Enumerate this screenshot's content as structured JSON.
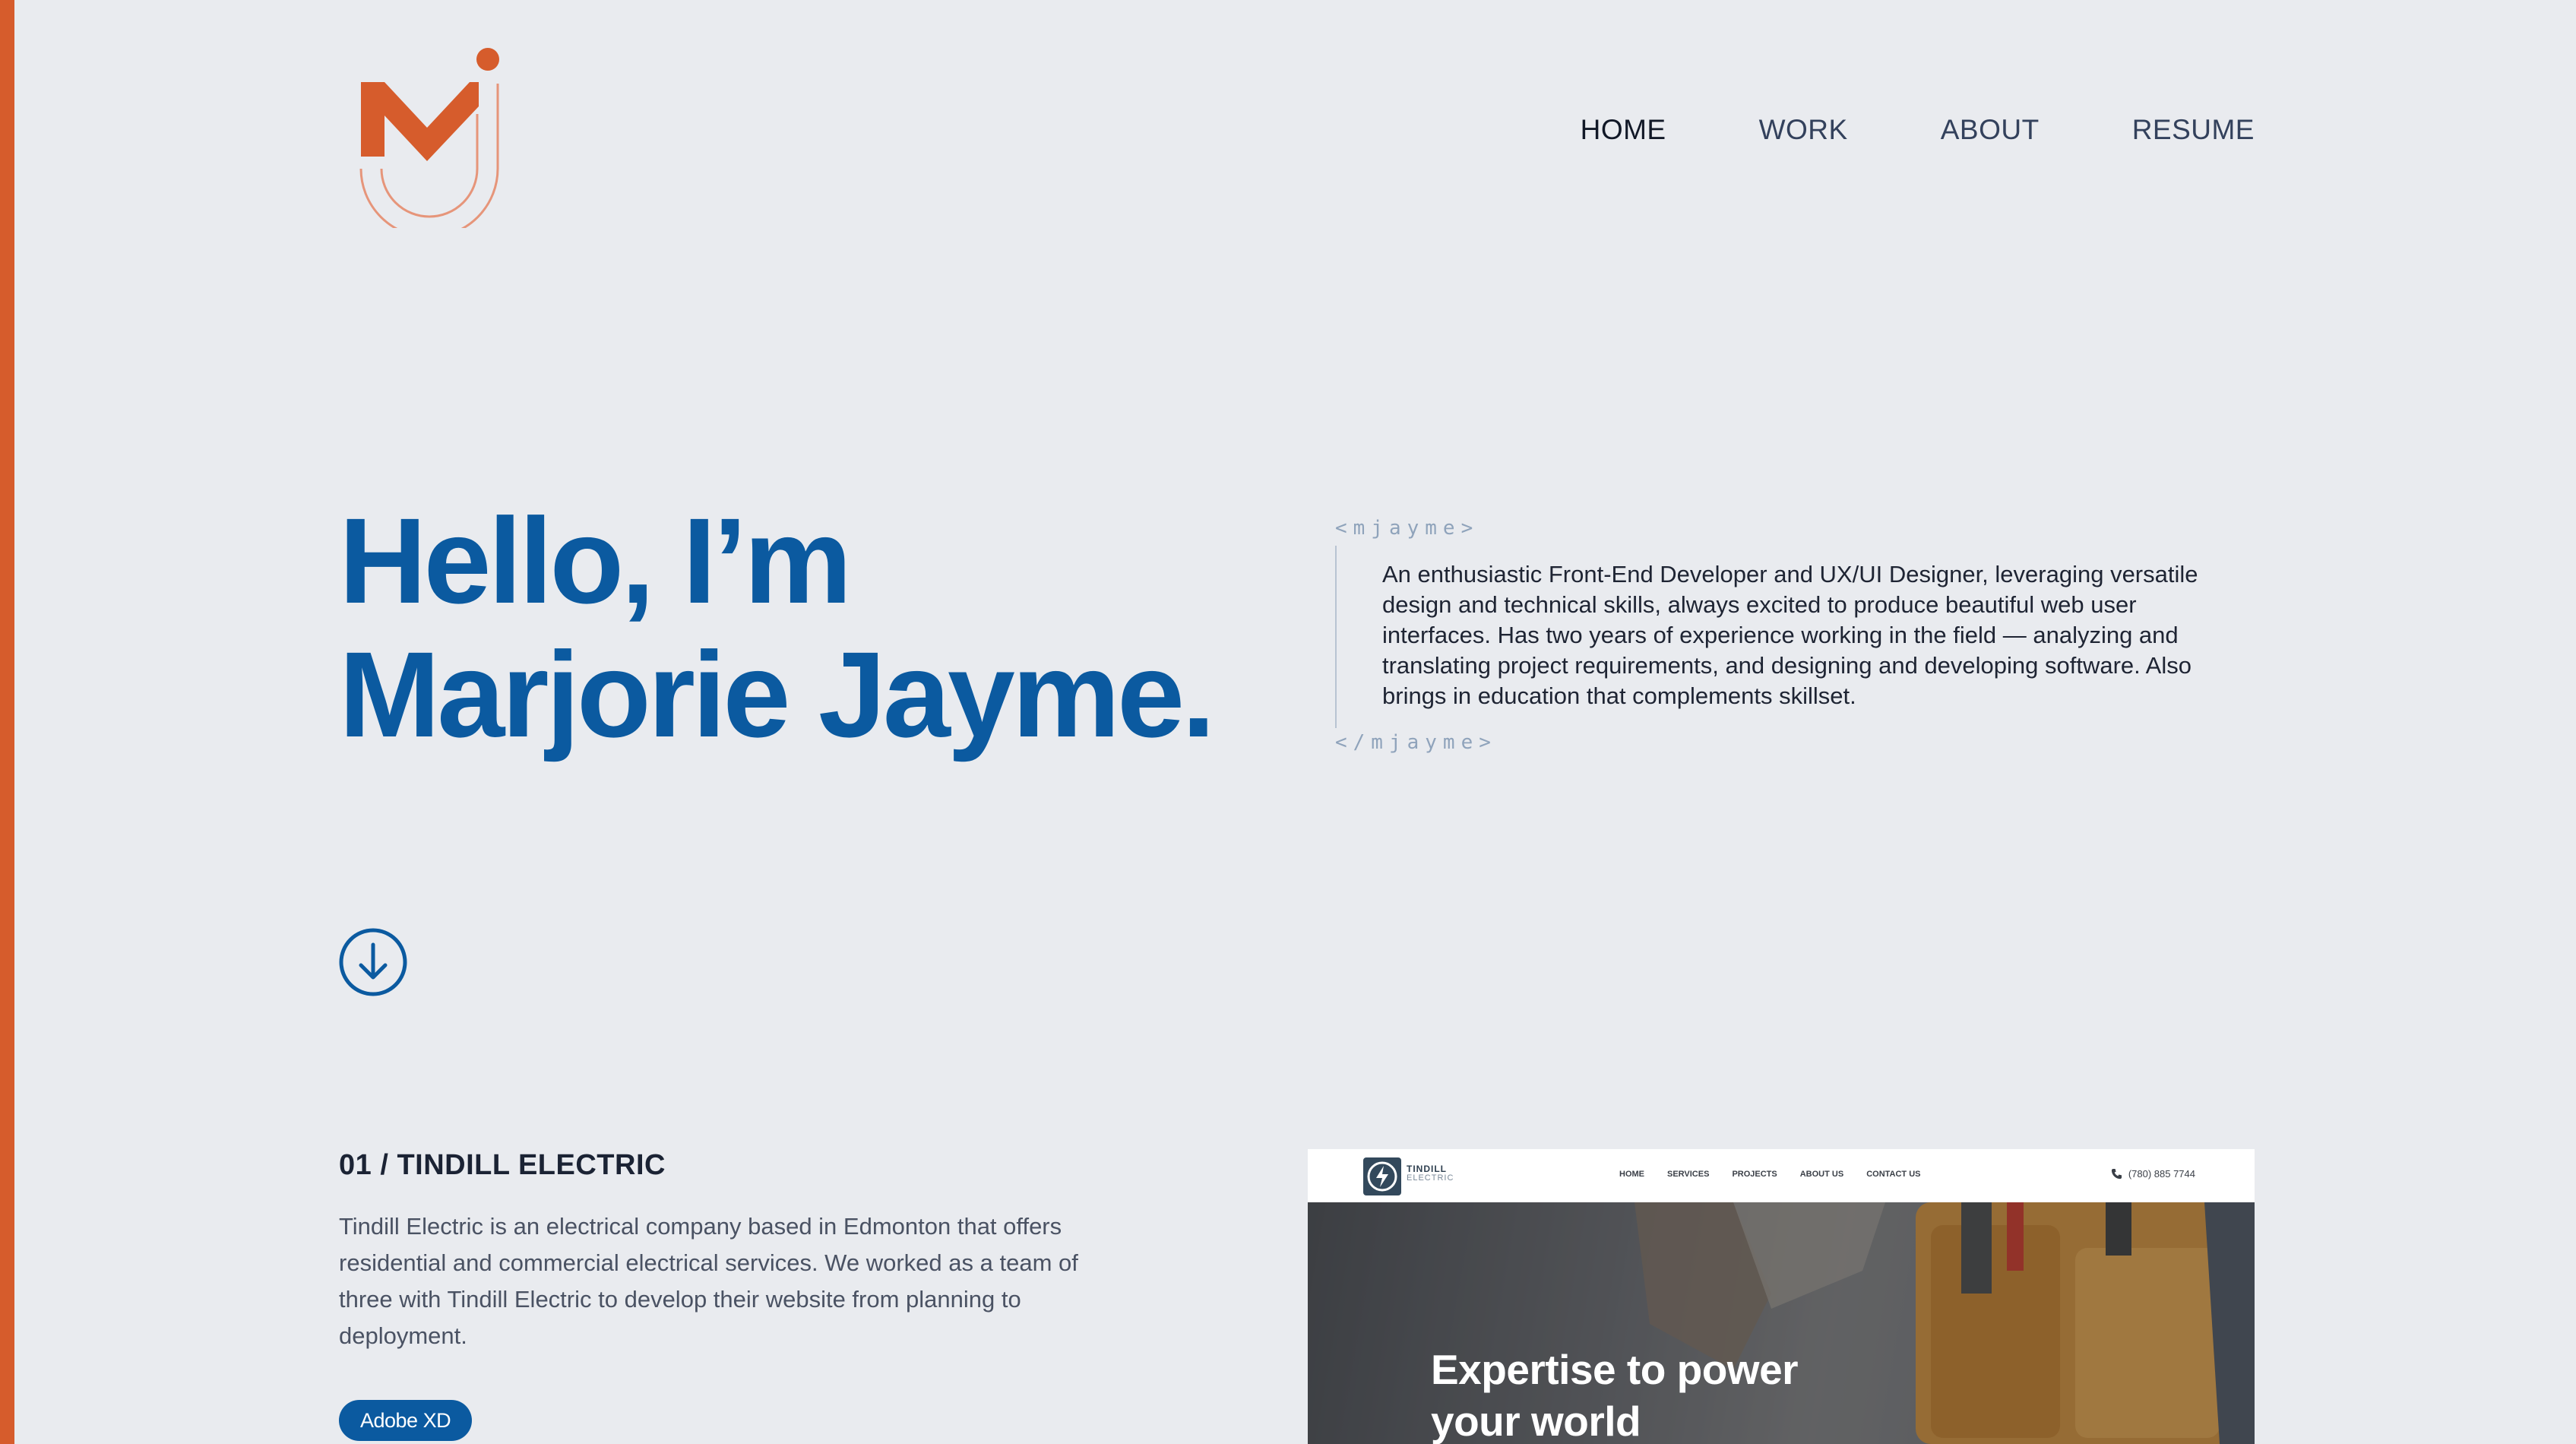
{
  "colors": {
    "accent_orange": "#d65c2c",
    "primary_blue": "#0b5aa0",
    "background": "#e9ebef",
    "text_dark": "#1e2433"
  },
  "header": {
    "logo_icon": "mj-monogram-logo",
    "nav": [
      {
        "label": "HOME",
        "active": true
      },
      {
        "label": "WORK",
        "active": false
      },
      {
        "label": "ABOUT",
        "active": false
      },
      {
        "label": "RESUME",
        "active": false
      }
    ]
  },
  "hero": {
    "title_line1": "Hello, I’m",
    "title_line2": "Marjorie Jayme.",
    "code_open": "<mjayme>",
    "code_close": "</mjayme>",
    "intro": "An enthusiastic Front-End Developer and UX/UI Designer, leveraging versatile design and technical skills, always excited to produce beautiful web user interfaces. Has two years of experience working in the field — analyzing and translating project requirements, and designing and developing software. Also brings in education that complements skillset.",
    "scroll_icon": "arrow-down-circle-icon"
  },
  "project": {
    "title": "01 / TINDILL ELECTRIC",
    "description": "Tindill Electric is an electrical company based in Edmonton that offers residential and commercial electrical services. We worked as a team of three with Tindill Electric to develop their website from planning to deployment.",
    "tags": [
      "Adobe XD"
    ],
    "preview": {
      "brand": "TINDILL",
      "brand_sub": "ELECTRIC",
      "nav": [
        "HOME",
        "SERVICES",
        "PROJECTS",
        "ABOUT US",
        "CONTACT US"
      ],
      "phone": "(780) 885 7744",
      "hero_line1": "Expertise to power",
      "hero_line2": "your world"
    }
  }
}
